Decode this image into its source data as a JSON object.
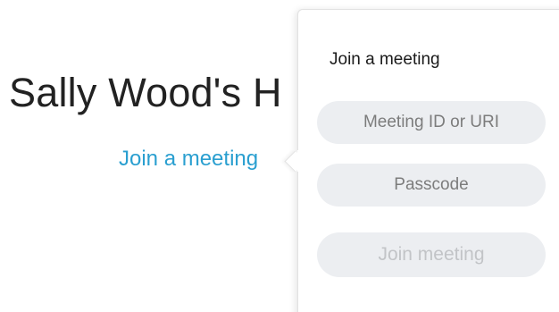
{
  "room": {
    "title": "Sally Wood's H"
  },
  "join_link": {
    "label": "Join a meeting"
  },
  "popover": {
    "title": "Join a meeting",
    "meeting_id": {
      "placeholder": "Meeting ID or URI",
      "value": ""
    },
    "passcode": {
      "placeholder": "Passcode",
      "value": ""
    },
    "join_button": {
      "label": "Join meeting",
      "state": "disabled"
    }
  },
  "colors": {
    "link": "#2a9fd0",
    "field_background": "#eceef1",
    "disabled_text": "#c2c4c7",
    "text": "#222222"
  }
}
